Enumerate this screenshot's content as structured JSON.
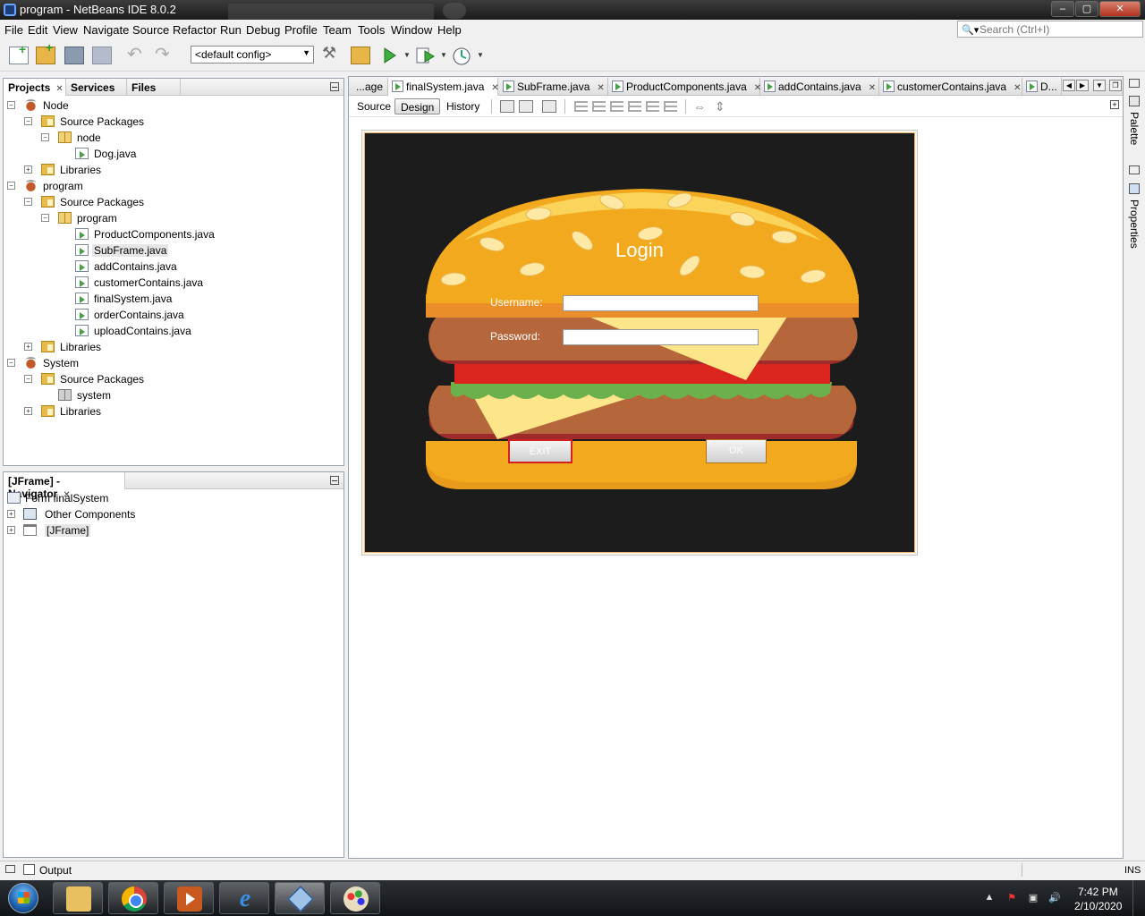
{
  "window": {
    "title": "program - NetBeans IDE 8.0.2",
    "minimize_glyph": "–",
    "maximize_glyph": "▢",
    "close_glyph": "✕"
  },
  "menu": [
    "File",
    "Edit",
    "View",
    "Navigate",
    "Source",
    "Refactor",
    "Run",
    "Debug",
    "Profile",
    "Team",
    "Tools",
    "Window",
    "Help"
  ],
  "search": {
    "placeholder": "Search (Ctrl+I)"
  },
  "toolbar": {
    "config": "<default config>"
  },
  "projects_panel": {
    "tabs": [
      "Projects",
      "Services",
      "Files"
    ],
    "tree": [
      {
        "label": "Node",
        "icon": "project-icon",
        "level": 0,
        "expander": "−"
      },
      {
        "label": "Source Packages",
        "icon": "source-folder-icon",
        "level": 1,
        "expander": "−"
      },
      {
        "label": "node",
        "icon": "package-icon",
        "level": 2,
        "expander": "−"
      },
      {
        "label": "Dog.java",
        "icon": "java-file-icon",
        "level": 3,
        "expander": ""
      },
      {
        "label": "Libraries",
        "icon": "library-folder-icon",
        "level": 1,
        "expander": "+"
      },
      {
        "label": "program",
        "icon": "project-icon",
        "level": 0,
        "expander": "−"
      },
      {
        "label": "Source Packages",
        "icon": "source-folder-icon",
        "level": 1,
        "expander": "−"
      },
      {
        "label": "program",
        "icon": "package-icon",
        "level": 2,
        "expander": "−"
      },
      {
        "label": "ProductComponents.java",
        "icon": "java-file-icon",
        "level": 3,
        "expander": ""
      },
      {
        "label": "SubFrame.java",
        "icon": "java-file-icon",
        "level": 3,
        "expander": "",
        "selected": true
      },
      {
        "label": "addContains.java",
        "icon": "java-file-icon",
        "level": 3,
        "expander": ""
      },
      {
        "label": "customerContains.java",
        "icon": "java-file-icon",
        "level": 3,
        "expander": ""
      },
      {
        "label": "finalSystem.java",
        "icon": "java-file-icon",
        "level": 3,
        "expander": ""
      },
      {
        "label": "orderContains.java",
        "icon": "java-file-icon",
        "level": 3,
        "expander": ""
      },
      {
        "label": "uploadContains.java",
        "icon": "java-file-icon",
        "level": 3,
        "expander": ""
      },
      {
        "label": "Libraries",
        "icon": "library-folder-icon",
        "level": 1,
        "expander": "+"
      },
      {
        "label": "System",
        "icon": "project-icon",
        "level": 0,
        "expander": "−"
      },
      {
        "label": "Source Packages",
        "icon": "source-folder-icon",
        "level": 1,
        "expander": "−"
      },
      {
        "label": "system",
        "icon": "empty-package-icon",
        "level": 2,
        "expander": ""
      },
      {
        "label": "Libraries",
        "icon": "library-folder-icon",
        "level": 1,
        "expander": "+"
      }
    ]
  },
  "navigator_panel": {
    "title": "[JFrame] - Navigator",
    "tree": [
      {
        "label": "Form finalSystem",
        "icon": "form-icon",
        "expander": ""
      },
      {
        "label": "Other Components",
        "icon": "components-icon",
        "expander": "+"
      },
      {
        "label": "[JFrame]",
        "icon": "jframe-icon",
        "expander": "+",
        "selected": true
      }
    ]
  },
  "editor": {
    "tabs": [
      {
        "label": "...age",
        "icon": false
      },
      {
        "label": "finalSystem.java",
        "active": true
      },
      {
        "label": "SubFrame.java"
      },
      {
        "label": "ProductComponents.java"
      },
      {
        "label": "addContains.java"
      },
      {
        "label": "customerContains.java"
      },
      {
        "label": "D..."
      }
    ],
    "views": [
      "Source",
      "Design",
      "History"
    ],
    "active_view": "Design"
  },
  "form": {
    "title": "Login",
    "username_label": "Username:",
    "password_label": "Password:",
    "username_value": "",
    "password_value": "",
    "exit_label": "EXIT",
    "ok_label": "OK"
  },
  "side_tabs": [
    "Palette",
    "Properties"
  ],
  "status": {
    "output": "Output",
    "mode": "INS"
  },
  "taskbar": {
    "time": "7:42 PM",
    "date": "2/10/2020",
    "apps": [
      "explorer-icon",
      "chrome-icon",
      "media-player-icon",
      "internet-explorer-icon",
      "netbeans-icon",
      "paint-icon"
    ]
  },
  "colors": {
    "bun": "#f2a91d",
    "bun_light": "#fbd55b",
    "patty": "#b5673b",
    "patty_dark": "#9e2a2a",
    "tomato": "#d9251d",
    "lettuce": "#6bb04a",
    "cheese": "#fde58a",
    "canvas": "#1c1c1c"
  }
}
